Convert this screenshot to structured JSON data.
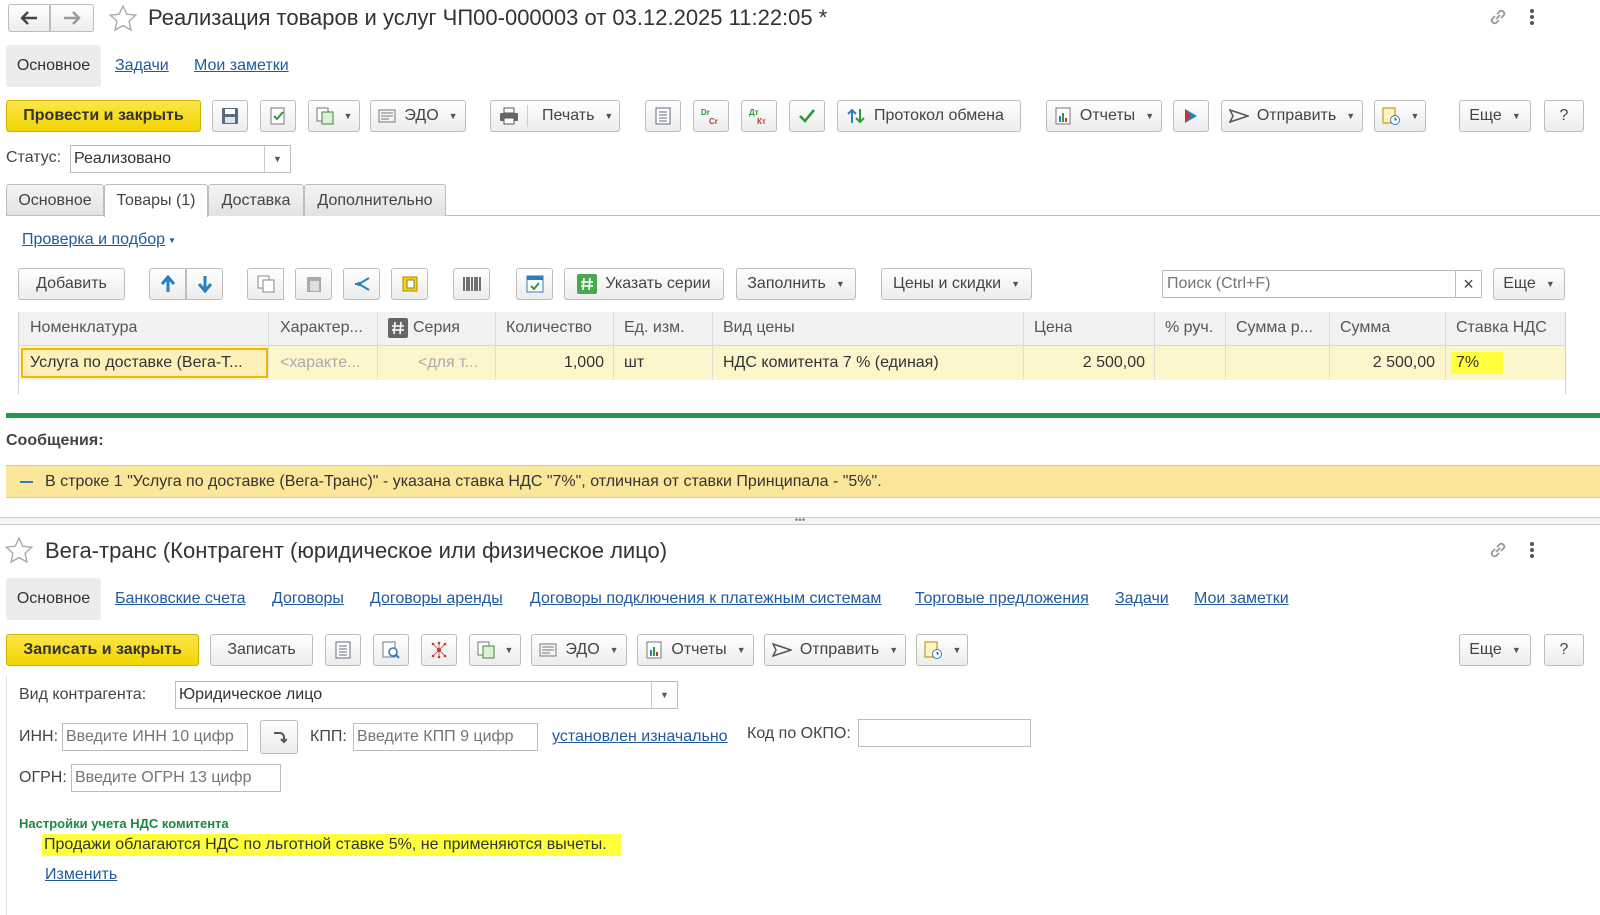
{
  "doc": {
    "title": "Реализация товаров и услуг ЧП00-000003 от 03.12.2025 11:22:05 *",
    "nav_tabs": [
      "Основное",
      "Задачи",
      "Мои заметки"
    ],
    "toolbar": {
      "post_close": "Провести и закрыть",
      "edo": "ЭДО",
      "print": "Печать",
      "exchange_protocol": "Протокол обмена",
      "reports": "Отчеты",
      "send": "Отправить",
      "more": "Еще",
      "help": "?"
    },
    "status_label": "Статус:",
    "status_value": "Реализовано",
    "tabs": [
      "Основное",
      "Товары (1)",
      "Доставка",
      "Дополнительно"
    ],
    "check_link": "Проверка и подбор",
    "table_toolbar": {
      "add": "Добавить",
      "series": "Указать серии",
      "fill": "Заполнить",
      "prices": "Цены и скидки",
      "search_placeholder": "Поиск (Ctrl+F)",
      "clear": "×",
      "more": "Еще"
    },
    "columns": [
      "Номенклатура",
      "Характер...",
      "Серия",
      "Количество",
      "Ед. изм.",
      "Вид цены",
      "Цена",
      "% руч.",
      "Сумма р...",
      "Сумма",
      "Ставка НДС"
    ],
    "row": {
      "item": "Услуга по доставке (Вега-Т...",
      "characteristic": "<характе...",
      "series": "<для т...",
      "qty": "1,000",
      "unit": "шт",
      "price_type": "НДС комитента 7 % (единая)",
      "price": "2 500,00",
      "manual_pct": "",
      "sum_manual": "",
      "sum": "2 500,00",
      "vat": "7%"
    }
  },
  "messages": {
    "header": "Сообщения:",
    "items": [
      "В строке 1 \"Услуга по доставке (Вега-Транс)\" - указана ставка НДС \"7%\", отличная от ставки Принципала - \"5%\"."
    ]
  },
  "counterparty": {
    "title": "Вега-транс (Контрагент (юридическое или физическое лицо)",
    "nav_tabs": [
      "Основное",
      "Банковские счета",
      "Договоры",
      "Договоры аренды",
      "Договоры подключения к платежным системам",
      "Торговые предложения",
      "Задачи",
      "Мои заметки"
    ],
    "toolbar": {
      "save_close": "Записать и закрыть",
      "save": "Записать",
      "edo": "ЭДО",
      "reports": "Отчеты",
      "send": "Отправить",
      "more": "Еще",
      "help": "?"
    },
    "kind_label": "Вид контрагента:",
    "kind_value": "Юридическое лицо",
    "inn_label": "ИНН:",
    "inn_placeholder": "Введите ИНН 10 цифр",
    "kpp_label": "КПП:",
    "kpp_placeholder": "Введите КПП 9 цифр",
    "kpp_link": "установлен изначально",
    "okpo_label": "Код по ОКПО:",
    "okpo_value": "",
    "ogrn_label": "ОГРН:",
    "ogrn_placeholder": "Введите ОГРН 13 цифр",
    "vat_settings_title": "Настройки учета НДС комитента",
    "vat_settings_text": "Продажи облагаются НДС по льготной ставке 5%, не применяются вычеты.",
    "change_link": "Изменить"
  },
  "colors": {
    "accent_yellow": "#f5d800",
    "link_blue": "#1f5aa0",
    "green_divider": "#1a9c4a",
    "message_bg": "#fbe79a",
    "highlight_yellow": "#ffff3c",
    "row_selected": "#fdf6cc"
  }
}
